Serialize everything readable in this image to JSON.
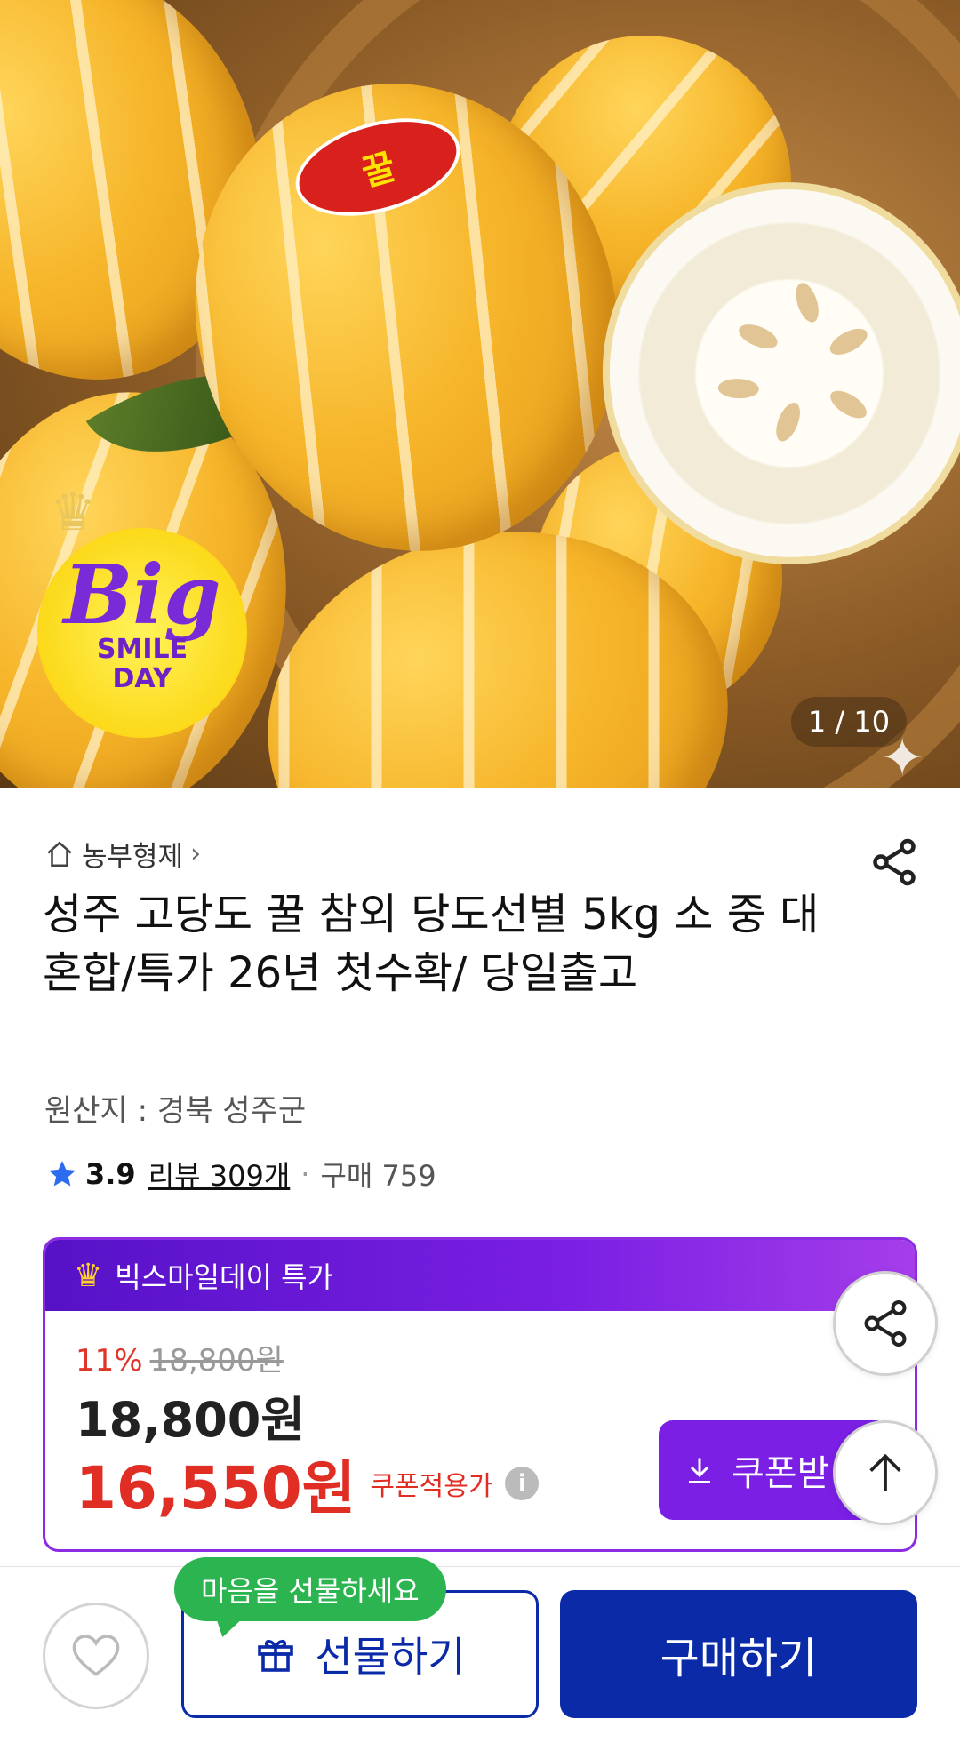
{
  "hero": {
    "image_alt": "",
    "sticker_text": "꿀",
    "badge": {
      "big": "Big",
      "line1": "SMILE",
      "line2": "DAY"
    },
    "counter": "1 / 10"
  },
  "breadcrumb": {
    "label": "농부형제",
    "chevron": "›"
  },
  "product": {
    "title": "성주 고당도 꿀 참외 당도선별 5kg 소 중 대 혼합/특가 26년 첫수확/ 당일출고",
    "origin": "원산지 : 경북 성주군"
  },
  "rating": {
    "score": "3.9",
    "reviews": "리뷰 309개",
    "separator": "·",
    "purchases": "구매 759"
  },
  "price_box": {
    "header": "빅스마일데이 특가",
    "discount": "11%",
    "original_price": "18,800원",
    "sale_price": "18,800원",
    "coupon_price": "16,550원",
    "coupon_label": "쿠폰적용가",
    "info_icon": "i",
    "coupon_button": "쿠폰받"
  },
  "bottom_bar": {
    "tooltip": "마음을 선물하세요",
    "gift_button": "선물하기",
    "buy_button": "구매하기"
  },
  "colors": {
    "primary_blue": "#0b2aa8",
    "purple": "#7a1fe3",
    "price_red": "#e02e25",
    "tooltip_green": "#2bb44f",
    "star_blue": "#2d6cf0"
  },
  "icons": [
    "home-icon",
    "chevron-right-icon",
    "share-icon",
    "star-icon",
    "crown-icon",
    "info-icon",
    "download-icon",
    "arrow-up-icon",
    "heart-icon",
    "gift-icon"
  ]
}
